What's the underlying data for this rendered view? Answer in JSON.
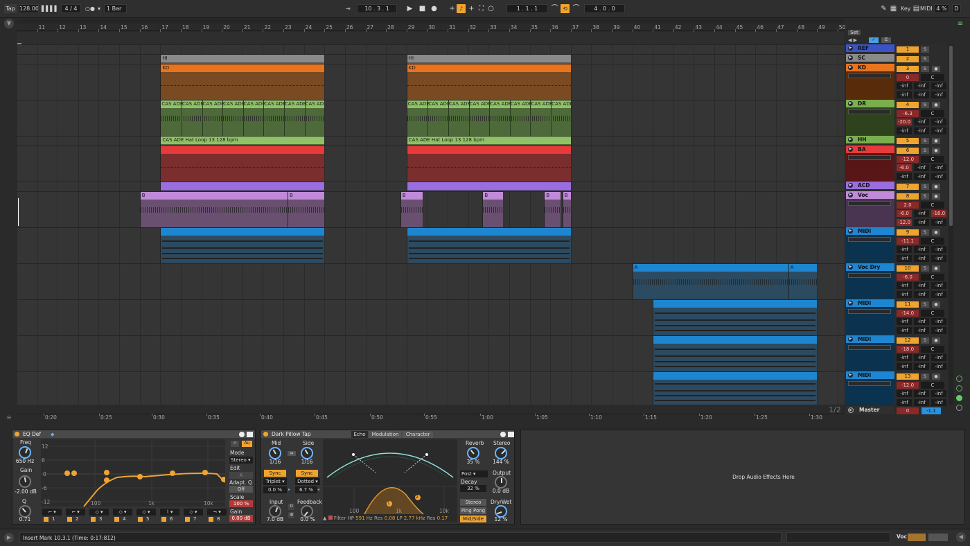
{
  "transport": {
    "tap": "Tap",
    "tempo": "128.00",
    "signature": "4 / 4",
    "quantization": "1 Bar",
    "arrangement_position": "10 .  3 .  1",
    "loop_start": "1 .  1 .  1",
    "loop_length": "4 .  0 .  0",
    "key_label": "Key",
    "midi_label": "MIDI",
    "cpu": "4 %",
    "disk": "D"
  },
  "ruler": {
    "bars": [
      "11",
      "12",
      "13",
      "14",
      "15",
      "16",
      "17",
      "18",
      "19",
      "20",
      "21",
      "22",
      "23",
      "24",
      "25",
      "26",
      "27",
      "28",
      "29",
      "30",
      "31",
      "32",
      "33",
      "34",
      "35",
      "36",
      "37",
      "38",
      "39",
      "40",
      "41",
      "42",
      "43",
      "44",
      "45",
      "46",
      "47",
      "48",
      "49",
      "50"
    ],
    "set_label": "Set"
  },
  "time_ruler": [
    "0:20",
    "0:25",
    "0:30",
    "0:35",
    "0:40",
    "0:45",
    "0:50",
    "0:55",
    "1:00",
    "1:05",
    "1:10",
    "1:15",
    "1:20",
    "1:25",
    "1:30"
  ],
  "page_indicator": "1/2",
  "tracks": [
    {
      "name": "REF",
      "color": "#3a54c8",
      "num": "1"
    },
    {
      "name": "SC",
      "color": "#8a8a8a",
      "num": "2"
    },
    {
      "name": "KD",
      "color": "#e8741e",
      "num": "3",
      "vol": "0",
      "pan": "C",
      "s1": "-inf",
      "s2": "-inf",
      "s3": "-inf",
      "s4": "-inf",
      "s5": "-inf",
      "s6": "-inf"
    },
    {
      "name": "DR",
      "color": "#7aae4e",
      "num": "4",
      "vol": "-6.3",
      "pan": "C",
      "s1": "-20.0",
      "s2": "-inf",
      "s3": "-inf",
      "s4": "-inf",
      "s5": "-inf",
      "s6": "-inf"
    },
    {
      "name": "HH",
      "color": "#7aae4e",
      "num": "5"
    },
    {
      "name": "BA",
      "color": "#e83a3a",
      "num": "6",
      "vol": "-12.0",
      "pan": "C",
      "s1": "-6.0",
      "s2": "-inf",
      "s3": "-inf",
      "s4": "-inf",
      "s5": "-inf",
      "s6": "-inf"
    },
    {
      "name": "ACD",
      "color": "#9a6ee0",
      "num": "7"
    },
    {
      "name": "Voc",
      "color": "#c08ad8",
      "num": "8",
      "vol": "2.0",
      "pan": "C",
      "s1": "-6.0",
      "s2": "-inf",
      "s3": "-16.0",
      "s4": "-12.0",
      "s5": "-inf",
      "s6": "-inf"
    },
    {
      "name": "MIDI",
      "color": "#1e86d0",
      "num": "9",
      "vol": "-11.1",
      "pan": "C",
      "s1": "-inf",
      "s2": "-inf",
      "s3": "-inf",
      "s4": "-inf",
      "s5": "-inf",
      "s6": "-inf"
    },
    {
      "name": "Voc Dry",
      "color": "#1e86d0",
      "num": "10",
      "vol": "-6.0",
      "pan": "C",
      "s1": "-inf",
      "s2": "-inf",
      "s3": "-inf",
      "s4": "-inf",
      "s5": "-inf",
      "s6": "-inf"
    },
    {
      "name": "MIDI",
      "color": "#1e86d0",
      "num": "11",
      "vol": "-14.0",
      "pan": "C",
      "s1": "-inf",
      "s2": "-inf",
      "s3": "-inf",
      "s4": "-inf",
      "s5": "-inf",
      "s6": "-inf"
    },
    {
      "name": "MIDI",
      "color": "#1e86d0",
      "num": "12",
      "vol": "-18.0",
      "pan": "C",
      "s1": "-inf",
      "s2": "-inf",
      "s3": "-inf",
      "s4": "-inf",
      "s5": "-inf",
      "s6": "-inf"
    },
    {
      "name": "MIDI",
      "color": "#1e86d0",
      "num": "13",
      "vol": "-12.0",
      "pan": "C",
      "s1": "-inf",
      "s2": "-inf",
      "s3": "-inf",
      "s4": "-inf",
      "s5": "-inf",
      "s6": "-inf"
    }
  ],
  "master": {
    "name": "Master",
    "vol": "0",
    "peak": "-1.1"
  },
  "clips": {
    "hi_label": "HI",
    "kd_label": "KD",
    "dr_label": "CAS ADE",
    "hh_label": "CAS ADE Hat Loop 13 128 bpm",
    "voc_b": "B",
    "vocdry_a": "A",
    "s_label": "S"
  },
  "eq": {
    "title": "EQ Def",
    "freq_label": "Freq",
    "freq_val": "650 Hz",
    "gain_label": "Gain",
    "gain_val": "-2.00 dB",
    "q_label": "Q",
    "q_val": "0.71",
    "db_ticks": [
      "12",
      "6",
      "0",
      "-6",
      "-12"
    ],
    "freq_ticks": [
      "100",
      "1k",
      "10k"
    ],
    "mode_label": "Mode",
    "mode_val": "Stereo",
    "edit_label": "Edit",
    "adapt_label": "Adapt. Q",
    "adapt_val": "Off",
    "scale_label": "Scale",
    "scale_val": "100 %",
    "out_gain_label": "Gain",
    "out_gain_val": "0.00 dB",
    "band_nums": [
      "1",
      "2",
      "3",
      "4",
      "5",
      "6",
      "7",
      "8"
    ],
    "au": "Au"
  },
  "echo": {
    "title": "Dark Pillow Tap",
    "tabs": [
      "Echo",
      "Modulation",
      "Character"
    ],
    "mid_label": "Mid",
    "mid_val": "1/16",
    "side_label": "Side",
    "side_val": "1/16",
    "sync": "Sync",
    "triplet": "Triplet",
    "dotted": "Dotted",
    "mid_pct": "0.0 %",
    "side_pct": "6.7 %",
    "input_label": "Input",
    "input_val": "7.0 dB",
    "feedback_label": "Feedback",
    "feedback_val": "0.0 %",
    "reverb_label": "Reverb",
    "reverb_val": "35 %",
    "stereo_label": "Stereo",
    "stereo_val": "144 %",
    "post": "Post",
    "decay_label": "Decay",
    "decay_val": "32 %",
    "output_label": "Output",
    "output_val": "0.0 dB",
    "drywet_label": "Dry/Wet",
    "drywet_val": "12 %",
    "btn_stereo": "Stereo",
    "btn_pingpong": "Ping Pong",
    "btn_midside": "Mid/Side",
    "filter_label": "Filter",
    "hp_label": "HP",
    "hp_val": "591 Hz",
    "res1_label": "Res",
    "res1_val": "0.08",
    "lp_label": "LP",
    "lp_val": "2.77 kHz",
    "res2_label": "Res",
    "res2_val": "0.17",
    "freq_ticks": [
      "100",
      "1k",
      "10k"
    ],
    "dot1": "1",
    "dot2": "2"
  },
  "drop_text": "Drop Audio Effects Here",
  "status": {
    "message": "Insert Mark 10.3.1 (Time: 0:17:812)",
    "track": "Voc"
  }
}
